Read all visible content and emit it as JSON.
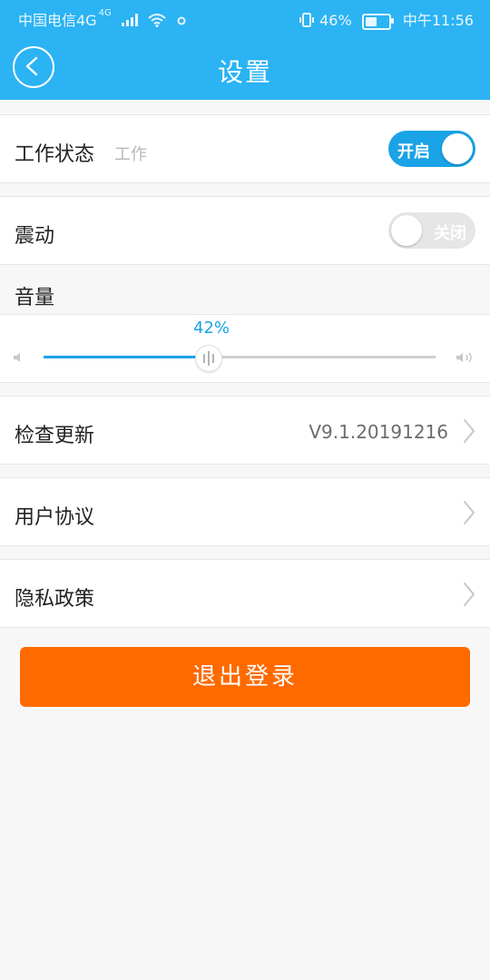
{
  "status_bar": {
    "carrier": "中国电信4G",
    "network_badge": "4G",
    "battery": "46%",
    "time": "中午11:56"
  },
  "header": {
    "title": "设置"
  },
  "work_status": {
    "label": "工作状态",
    "sub_label": "工作",
    "toggle_label": "开启",
    "toggle_on": true
  },
  "vibration": {
    "label": "震动",
    "toggle_label": "关闭",
    "toggle_on": false
  },
  "volume": {
    "label": "音量",
    "percent_text": "42%",
    "level": 0.42
  },
  "menu": {
    "check_update": {
      "label": "检查更新",
      "value": "V9.1.20191216"
    },
    "user_agreement": {
      "label": "用户协议"
    },
    "privacy_policy": {
      "label": "隐私政策"
    }
  },
  "logout": {
    "label": "退出登录"
  },
  "colors": {
    "primary": "#2bb3f3",
    "accent": "#1aa3e6",
    "logout": "#ff6a00"
  }
}
